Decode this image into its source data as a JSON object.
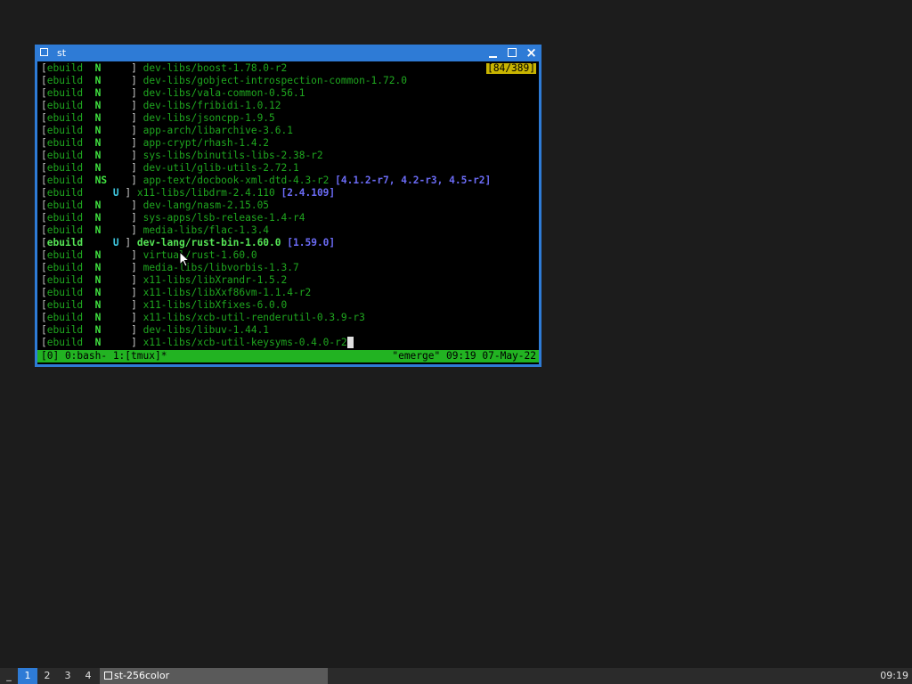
{
  "window": {
    "title": "st",
    "close_glyph": "×"
  },
  "terminal": {
    "counter": "[84/389]",
    "lines": [
      {
        "flag": "N ",
        "pkg": "dev-libs/boost-1.78.0-r2",
        "ver": ""
      },
      {
        "flag": "N ",
        "pkg": "dev-libs/gobject-introspection-common-1.72.0",
        "ver": ""
      },
      {
        "flag": "N ",
        "pkg": "dev-libs/vala-common-0.56.1",
        "ver": ""
      },
      {
        "flag": "N ",
        "pkg": "dev-libs/fribidi-1.0.12",
        "ver": ""
      },
      {
        "flag": "N ",
        "pkg": "dev-libs/jsoncpp-1.9.5",
        "ver": ""
      },
      {
        "flag": "N ",
        "pkg": "app-arch/libarchive-3.6.1",
        "ver": ""
      },
      {
        "flag": "N ",
        "pkg": "app-crypt/rhash-1.4.2",
        "ver": ""
      },
      {
        "flag": "N ",
        "pkg": "sys-libs/binutils-libs-2.38-r2",
        "ver": ""
      },
      {
        "flag": "N ",
        "pkg": "dev-util/glib-utils-2.72.1",
        "ver": ""
      },
      {
        "flag": "NS",
        "pkg": "app-text/docbook-xml-dtd-4.3-r2",
        "ver": "[4.1.2-r7, 4.2-r3, 4.5-r2]"
      },
      {
        "flag": "U",
        "pkg": "x11-libs/libdrm-2.4.110",
        "ver": "[2.4.109]"
      },
      {
        "flag": "N ",
        "pkg": "dev-lang/nasm-2.15.05",
        "ver": ""
      },
      {
        "flag": "N ",
        "pkg": "sys-apps/lsb-release-1.4-r4",
        "ver": ""
      },
      {
        "flag": "N ",
        "pkg": "media-libs/flac-1.3.4",
        "ver": ""
      },
      {
        "flag": "U",
        "pkg": "dev-lang/rust-bin-1.60.0",
        "ver": "[1.59.0]",
        "bold": true
      },
      {
        "flag": "N ",
        "pkg": "virtual/rust-1.60.0",
        "ver": ""
      },
      {
        "flag": "N ",
        "pkg": "media-libs/libvorbis-1.3.7",
        "ver": ""
      },
      {
        "flag": "N ",
        "pkg": "x11-libs/libXrandr-1.5.2",
        "ver": ""
      },
      {
        "flag": "N ",
        "pkg": "x11-libs/libXxf86vm-1.1.4-r2",
        "ver": ""
      },
      {
        "flag": "N ",
        "pkg": "x11-libs/libXfixes-6.0.0",
        "ver": ""
      },
      {
        "flag": "N ",
        "pkg": "x11-libs/xcb-util-renderutil-0.3.9-r3",
        "ver": ""
      },
      {
        "flag": "N ",
        "pkg": "dev-libs/libuv-1.44.1",
        "ver": ""
      },
      {
        "flag": "N ",
        "pkg": "x11-libs/xcb-util-keysyms-0.4.0-r2",
        "ver": "",
        "cursor": true
      }
    ],
    "status_left": "[0] 0:bash- 1:[tmux]*",
    "status_right": "\"emerge\" 09:19 07-May-22"
  },
  "taskbar": {
    "menu": "_",
    "workspaces": [
      "1",
      "2",
      "3",
      "4"
    ],
    "task": "st-256color",
    "clock": "09:19"
  },
  "colors": {
    "desktop": "#1c1c1c",
    "window_frame": "#2e7bd6",
    "status_bar": "#22b322",
    "counter_bg": "#c8b400"
  }
}
